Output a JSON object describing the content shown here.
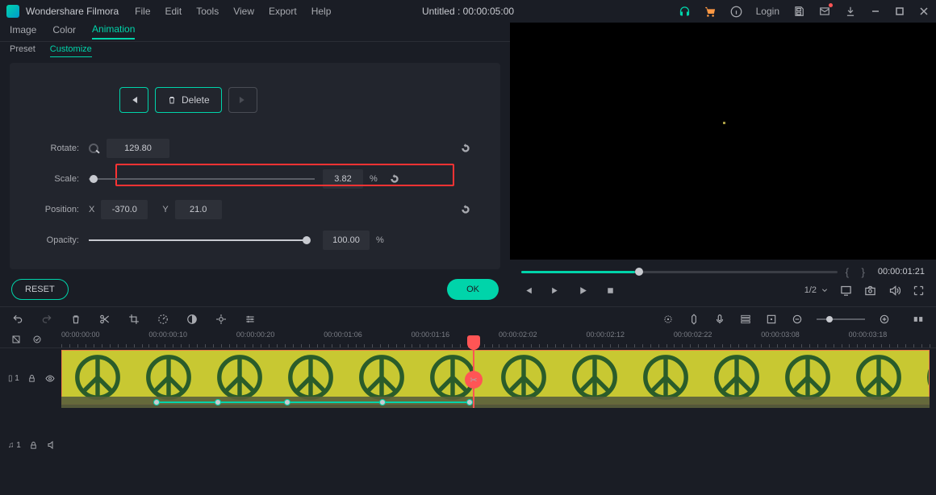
{
  "app": {
    "name": "Wondershare Filmora"
  },
  "menus": [
    "File",
    "Edit",
    "Tools",
    "View",
    "Export",
    "Help"
  ],
  "title": "Untitled : 00:00:05:00",
  "header_actions": {
    "login": "Login"
  },
  "tabs": {
    "image": "Image",
    "color": "Color",
    "animation": "Animation"
  },
  "sub_tabs": {
    "preset": "Preset",
    "customize": "Customize"
  },
  "keyframe_buttons": {
    "delete": "Delete"
  },
  "props": {
    "rotate": {
      "label": "Rotate:",
      "value": "129.80"
    },
    "scale": {
      "label": "Scale:",
      "value": "3.82"
    },
    "position": {
      "label": "Position:",
      "x_label": "X",
      "x": "-370.0",
      "y_label": "Y",
      "y": "21.0"
    },
    "opacity": {
      "label": "Opacity:",
      "value": "100.00"
    }
  },
  "buttons": {
    "reset": "RESET",
    "ok": "OK"
  },
  "preview": {
    "timecode": "00:00:01:21",
    "ratio": "1/2"
  },
  "ruler_marks": [
    "00:00:00:00",
    "00:00:00:10",
    "00:00:00:20",
    "00:00:01:06",
    "00:00:01:16",
    "00:00:02:02",
    "00:00:02:12",
    "00:00:02:22",
    "00:00:03:08",
    "00:00:03:18"
  ],
  "tracks": {
    "video": "▯ 1",
    "audio": "♫ 1"
  },
  "pct_symbol": "%"
}
